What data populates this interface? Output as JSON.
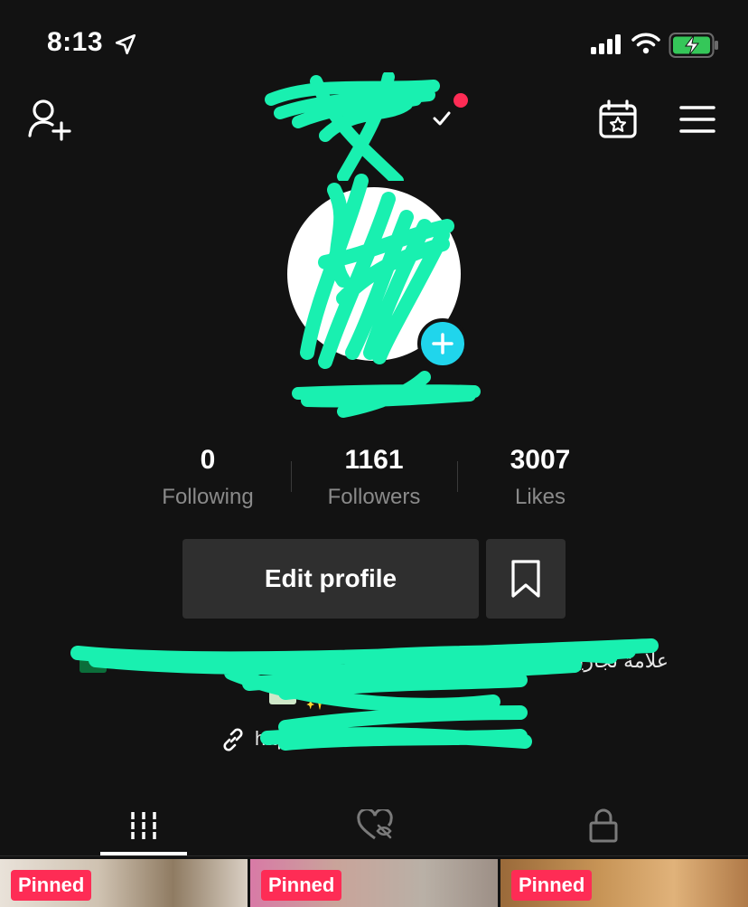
{
  "status_bar": {
    "time": "8:13"
  },
  "profile": {
    "stats": [
      {
        "value": "0",
        "label": "Following"
      },
      {
        "value": "1161",
        "label": "Followers"
      },
      {
        "value": "3007",
        "label": "Likes"
      }
    ],
    "edit_button": "Edit profile",
    "bio_line": "علامة تجارية متخصصة",
    "link": "http://..."
  },
  "tabs": [
    {
      "icon": "grid-icon",
      "active": true
    },
    {
      "icon": "liked-hidden-icon",
      "active": false
    },
    {
      "icon": "lock-icon",
      "active": false
    }
  ],
  "videos": [
    {
      "badge": "Pinned"
    },
    {
      "badge": "Pinned"
    },
    {
      "badge": "Pinned"
    }
  ],
  "colors": {
    "background": "#121212",
    "accent_red": "#fe2c55",
    "accent_cyan": "#20d5ec",
    "scribble": "#19f0b0"
  }
}
